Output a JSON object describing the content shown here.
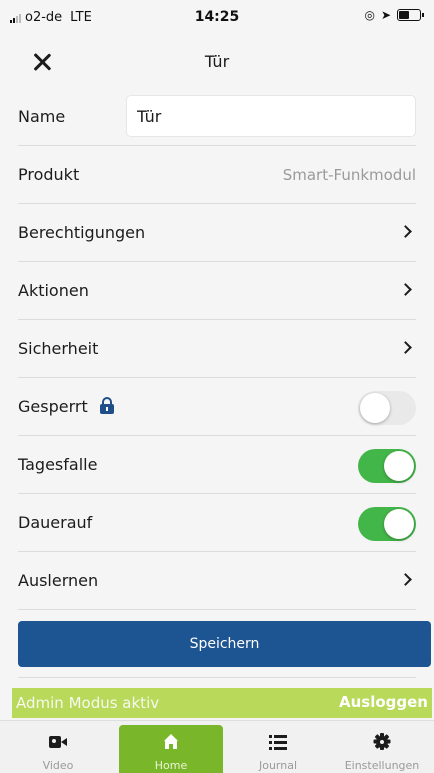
{
  "status_bar": {
    "carrier": "o2-de",
    "network": "LTE",
    "time": "14:25"
  },
  "nav": {
    "title": "Tür",
    "close_icon": "close-icon"
  },
  "form": {
    "name_label": "Name",
    "name_value": "Tür",
    "product_label": "Produkt",
    "product_value": "Smart-Funkmodul",
    "permissions_label": "Berechtigungen",
    "actions_label": "Aktionen",
    "security_label": "Sicherheit",
    "locked_label": "Gesperrt",
    "locked_on": false,
    "day_latch_label": "Tagesfalle",
    "day_latch_on": true,
    "permanent_open_label": "Dauerauf",
    "permanent_open_on": true,
    "unlearn_label": "Auslernen"
  },
  "save_button": {
    "label": "Speichern",
    "color": "#1d5492"
  },
  "admin_banner": {
    "text": "Admin Modus aktiv",
    "logout_label": "Ausloggen",
    "color": "#b8d959"
  },
  "tabs": [
    {
      "label": "Video",
      "icon": "video-icon",
      "active": false
    },
    {
      "label": "Home",
      "icon": "home-icon",
      "active": true
    },
    {
      "label": "Journal",
      "icon": "list-icon",
      "active": false
    },
    {
      "label": "Einstellungen",
      "icon": "gear-icon",
      "active": false
    }
  ],
  "colors": {
    "accent_green": "#7ab62a",
    "toggle_on": "#43b649",
    "lock_blue": "#1f4e8a"
  }
}
